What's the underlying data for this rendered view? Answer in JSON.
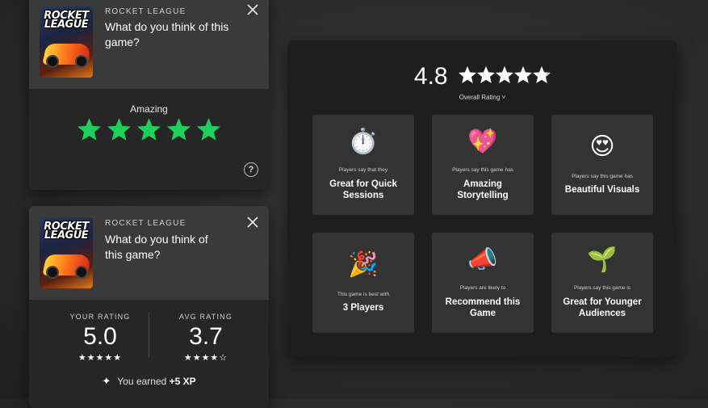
{
  "card1": {
    "brand": "ROCKET LEAGUE",
    "cover_logo_text": "ROCKET LEAGUE",
    "question": "What do you think of this game?",
    "rating_label": "Amazing",
    "star_count": 5,
    "star_color": "#1fcf5c",
    "help": "?"
  },
  "card2": {
    "brand": "ROCKET LEAGUE",
    "cover_logo_text": "ROCKET LEAGUE",
    "question": "What do you think of this game?",
    "your_rating_label": "YOUR RATING",
    "your_rating_value": "5.0",
    "your_rating_stars": "★★★★★",
    "avg_rating_label": "AVG RATING",
    "avg_rating_value": "3.7",
    "avg_rating_stars": "★★★★☆",
    "xp_prefix": "You earned",
    "xp_amount": "+5 XP"
  },
  "panel": {
    "overall_score": "4.8",
    "overall_stars": 4.8,
    "overall_label": "Overall Rating ˅",
    "tiles": [
      {
        "icon": "stopwatch-icon",
        "emoji": "⏱️",
        "caption": "Players say that they",
        "title": "Great for Quick Sessions"
      },
      {
        "icon": "sparkling-heart-icon",
        "emoji": "💖",
        "caption": "Players say this game has",
        "title": "Amazing Storytelling"
      },
      {
        "icon": "heart-eyes-icon",
        "emoji": "😍",
        "caption": "Players say this game has",
        "title": "Beautiful Visuals"
      },
      {
        "icon": "party-popper-icon",
        "emoji": "🎉",
        "caption": "This game is best with",
        "title": "3 Players"
      },
      {
        "icon": "megaphone-icon",
        "emoji": "📣",
        "caption": "Players are likely to",
        "title": "Recommend this Game"
      },
      {
        "icon": "seedling-icon",
        "emoji": "🌱",
        "caption": "Players say this game is",
        "title": "Great for Younger Audiences"
      }
    ]
  }
}
